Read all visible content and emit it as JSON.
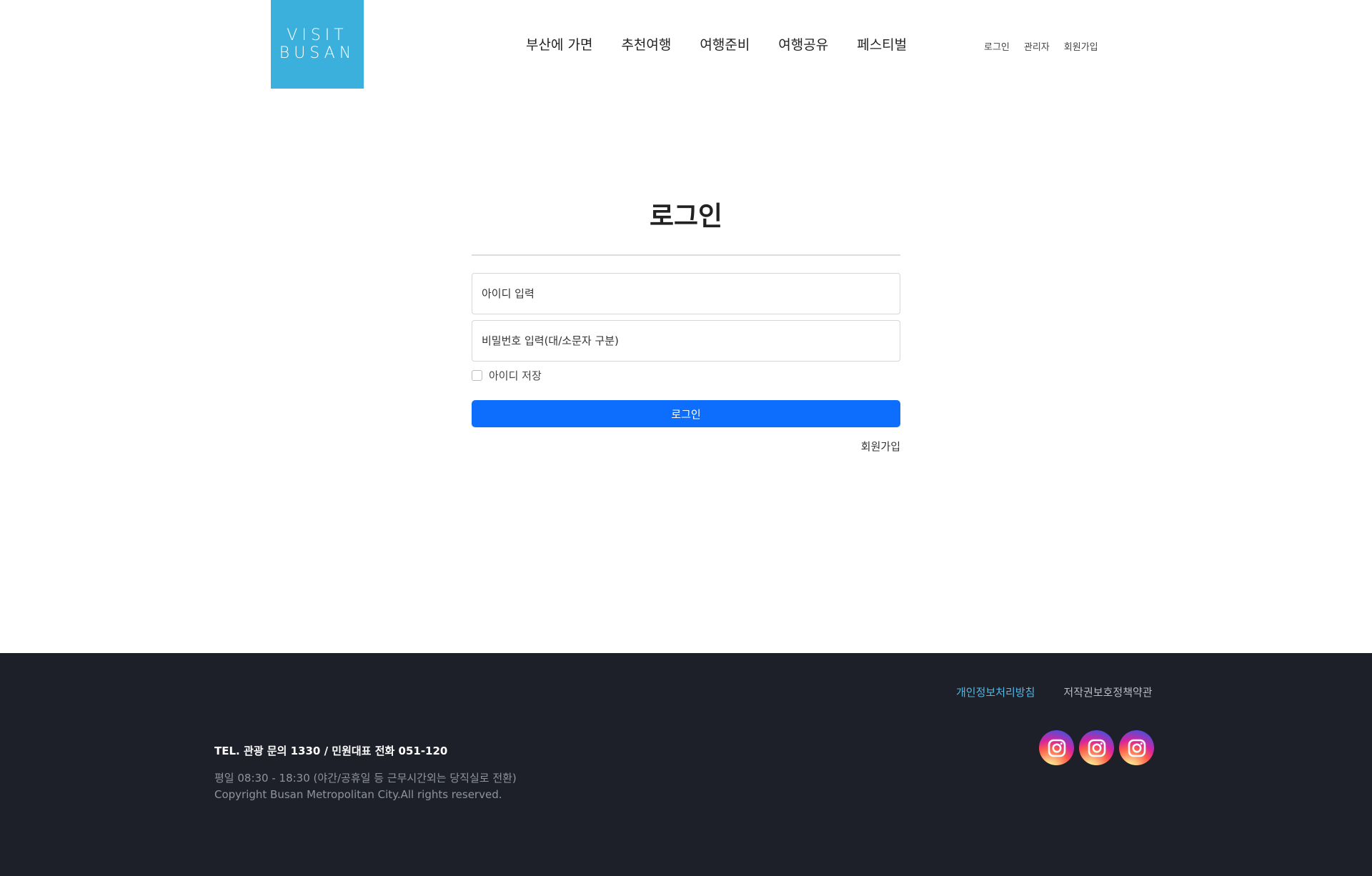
{
  "header": {
    "logo_line1": "VISIT",
    "logo_line2": "BUSAN",
    "nav": [
      "부산에 가면",
      "추천여행",
      "여행준비",
      "여행공유",
      "페스티벌"
    ],
    "util": [
      "로그인",
      "관리자",
      "회원가입"
    ]
  },
  "login": {
    "title": "로그인",
    "id_placeholder": "아이디 입력",
    "pw_placeholder": "비밀번호 입력(대/소문자 구분)",
    "remember_label": "아이디 저장",
    "submit_label": "로그인",
    "signup_label": "회원가입"
  },
  "footer": {
    "privacy_label": "개인정보처리방침",
    "copyright_policy_label": "저작권보호정책약관",
    "tel": "TEL. 관광 문의 1330 / 민원대표 전화 051-120",
    "hours": "평일 08:30 - 18:30 (야간/공휴일 등 근무시간외는 당직실로 전환)",
    "copyright": "Copyright Busan Metropolitan City.All rights reserved.",
    "sns_icons": [
      "instagram-icon",
      "instagram-icon",
      "instagram-icon"
    ]
  },
  "colors": {
    "logo_bg": "#3bb0dc",
    "primary_button": "#0d6efd",
    "footer_bg": "#1e2029",
    "footer_link_accent": "#4fb8e4"
  }
}
